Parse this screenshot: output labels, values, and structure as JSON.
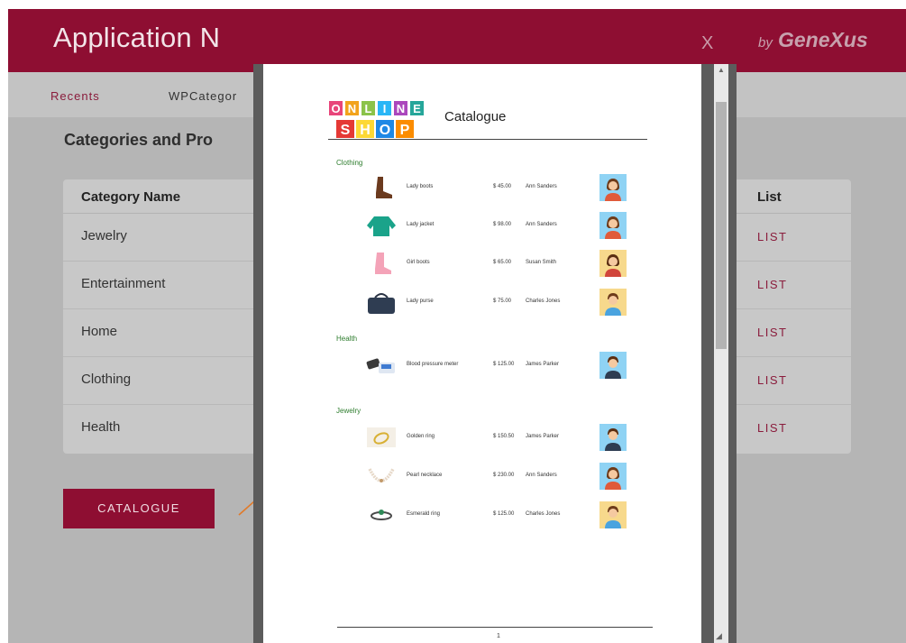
{
  "app": {
    "title": "Application N",
    "byline": "by",
    "brand": "GeneXus"
  },
  "nav": {
    "recents": "Recents",
    "current": "WPCategor"
  },
  "page_title": "Categories and Pro",
  "grid": {
    "headers": {
      "name": "Category Name",
      "list": "List"
    },
    "rows": [
      {
        "name": "Jewelry",
        "list": "LIST"
      },
      {
        "name": "Entertainment",
        "list": "LIST"
      },
      {
        "name": "Home",
        "list": "LIST"
      },
      {
        "name": "Clothing",
        "list": "LIST"
      },
      {
        "name": "Health",
        "list": "LIST"
      }
    ]
  },
  "catalogue_button": "CATALOGUE",
  "modal": {
    "close": "X",
    "logo_line1": "ONLINE",
    "logo_line2": "SHOP",
    "title": "Catalogue",
    "page_number": "1",
    "sections": [
      {
        "name": "Clothing",
        "items": [
          {
            "product": "Lady boots",
            "price": "$ 45.00",
            "seller": "Ann Sanders",
            "thumb": "boot-icon",
            "avatar": "female-avatar-icon"
          },
          {
            "product": "Lady jacket",
            "price": "$ 98.00",
            "seller": "Ann Sanders",
            "thumb": "jacket-icon",
            "avatar": "female-avatar-icon"
          },
          {
            "product": "Girl boots",
            "price": "$ 65.00",
            "seller": "Susan Smith",
            "thumb": "pink-boot-icon",
            "avatar": "female-avatar-icon"
          },
          {
            "product": "Lady purse",
            "price": "$ 75.00",
            "seller": "Charles Jones",
            "thumb": "purse-icon",
            "avatar": "male-avatar-icon"
          }
        ]
      },
      {
        "name": "Health",
        "items": [
          {
            "product": "Blood pressure meter",
            "price": "$ 125.00",
            "seller": "James Parker",
            "thumb": "blood-pressure-icon",
            "avatar": "male-avatar-icon"
          }
        ]
      },
      {
        "name": "Jewelry",
        "items": [
          {
            "product": "Golden ring",
            "price": "$ 150.50",
            "seller": "James Parker",
            "thumb": "ring-icon",
            "avatar": "male-avatar-icon"
          },
          {
            "product": "Pearl necklace",
            "price": "$ 230.00",
            "seller": "Ann Sanders",
            "thumb": "necklace-icon",
            "avatar": "female-avatar-icon"
          },
          {
            "product": "Esmerald ring",
            "price": "$ 125.00",
            "seller": "Charles Jones",
            "thumb": "ring-icon",
            "avatar": "male-avatar-icon"
          }
        ]
      }
    ]
  },
  "colors": {
    "accent": "#8e0e32",
    "link": "#8a1c3c",
    "section_green": "#2e7d2e"
  }
}
